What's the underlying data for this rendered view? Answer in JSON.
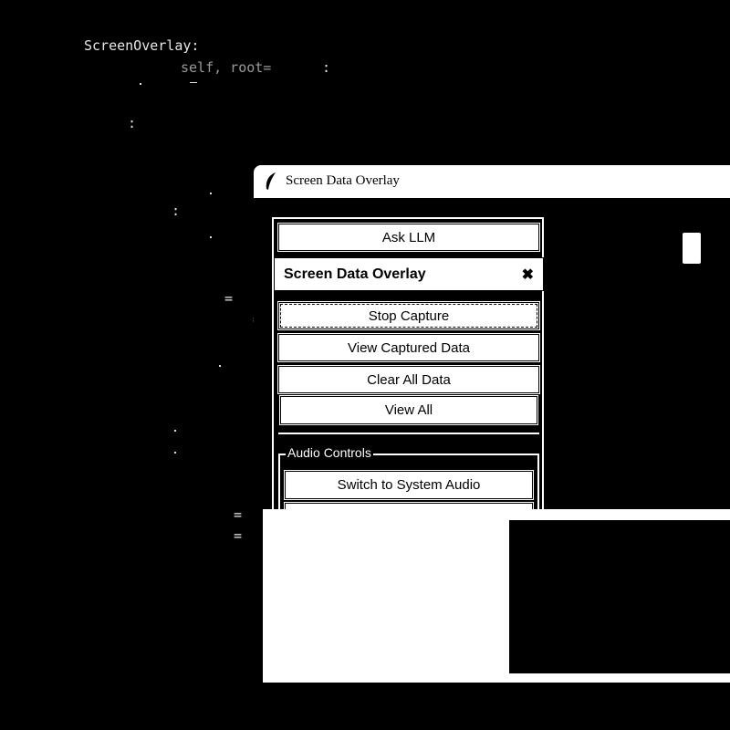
{
  "editor": {
    "line1": "ScreenOverlay:",
    "line2": "self, root=",
    "line2_colon": ":",
    "colon_a": ":",
    "colon_b": ":",
    "eq_a": "=",
    "eq_b": "=",
    "eq_c": "=",
    "eq_d": "=",
    "eq_e": "=",
    "eq_f": "="
  },
  "window": {
    "title": "Screen Data Overlay",
    "icon": "feather-icon"
  },
  "panel": {
    "ask_llm_label": "Ask LLM",
    "header_title": "Screen Data Overlay",
    "close_glyph": "✖",
    "stop_capture_label": "Stop Capture",
    "view_captured_label": "View Captured Data",
    "clear_all_label": "Clear All Data",
    "view_all_label": "View All",
    "audio_group_label": "Audio Controls",
    "switch_audio_label": "Switch to System Audio"
  },
  "colors": {
    "background": "#000000",
    "foreground": "#ffffff"
  }
}
